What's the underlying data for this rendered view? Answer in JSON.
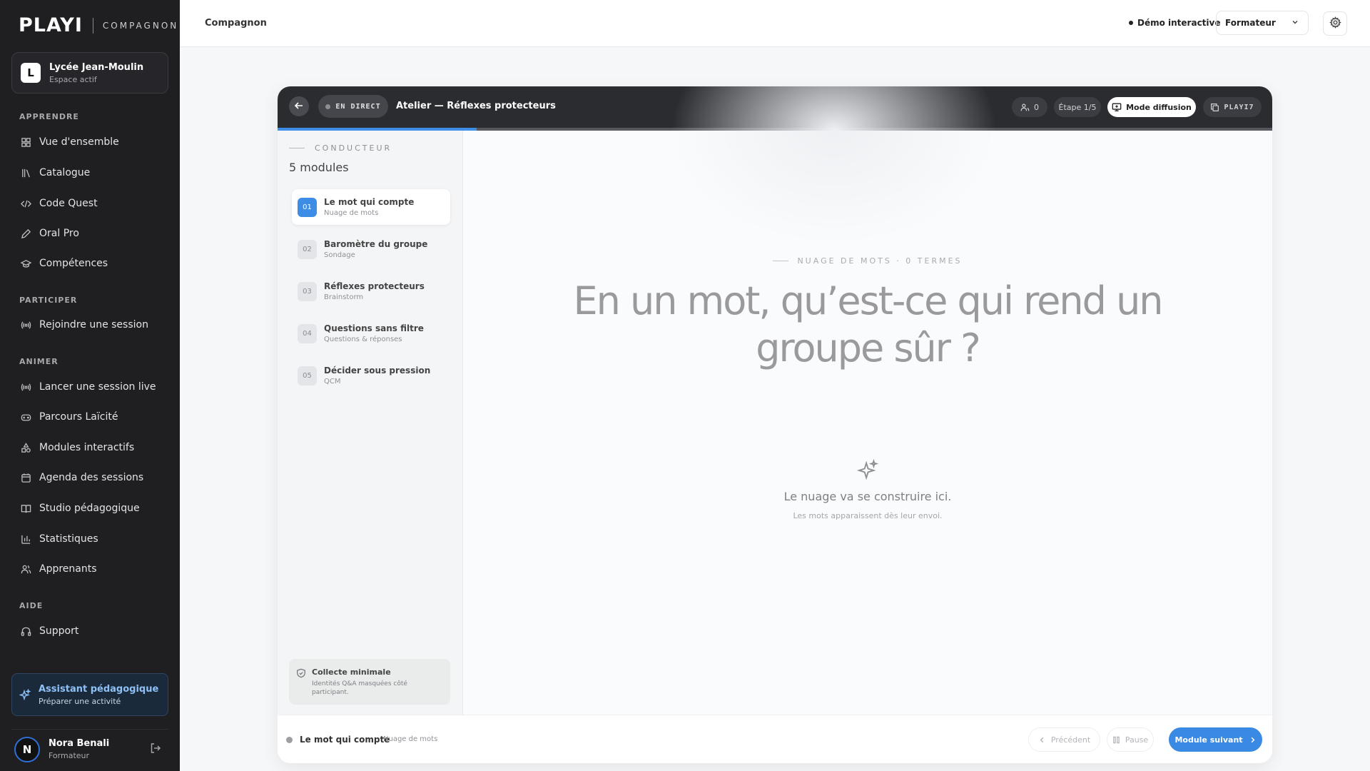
{
  "brand": {
    "logo": "PLAYI",
    "sub": "COMPAGNON"
  },
  "workspace": {
    "initial": "L",
    "name": "Lycée Jean-Moulin",
    "status": "Espace actif"
  },
  "sidebar": {
    "sections": [
      {
        "label": "APPRENDRE",
        "items": [
          {
            "label": "Vue d'ensemble",
            "icon": "grid-icon"
          },
          {
            "label": "Catalogue",
            "icon": "library-icon"
          },
          {
            "label": "Code Quest",
            "icon": "code-icon"
          },
          {
            "label": "Oral Pro",
            "icon": "pen-icon"
          },
          {
            "label": "Compétences",
            "icon": "graduation-cap-icon"
          }
        ]
      },
      {
        "label": "PARTICIPER",
        "items": [
          {
            "label": "Rejoindre une session",
            "icon": "broadcast-icon"
          }
        ]
      },
      {
        "label": "ANIMER",
        "items": [
          {
            "label": "Lancer une session live",
            "icon": "broadcast-icon"
          },
          {
            "label": "Parcours Laïcité",
            "icon": "gamepad-icon"
          },
          {
            "label": "Modules interactifs",
            "icon": "shapes-icon"
          },
          {
            "label": "Agenda des sessions",
            "icon": "calendar-icon"
          },
          {
            "label": "Studio pédagogique",
            "icon": "book-icon"
          },
          {
            "label": "Statistiques",
            "icon": "bar-chart-icon"
          },
          {
            "label": "Apprenants",
            "icon": "users-icon"
          }
        ]
      },
      {
        "label": "AIDE",
        "items": [
          {
            "label": "Support",
            "icon": "headphones-icon"
          }
        ]
      }
    ],
    "assistant": {
      "title": "Assistant pédagogique",
      "subtitle": "Préparer une activité"
    },
    "user": {
      "initial": "N",
      "name": "Nora Benali",
      "role": "Formateur"
    }
  },
  "topbar": {
    "title": "Compagnon",
    "demo": "Démo interactive",
    "role_selected": "Formateur"
  },
  "session": {
    "live_label": "EN DIRECT",
    "title": "Atelier — Réflexes protecteurs",
    "participants": "0",
    "step": "Étape 1/5",
    "broadcast_label": "Mode diffusion",
    "code": "PLAYI7",
    "progress_fraction": 0.2
  },
  "modules": {
    "label": "CONDUCTEUR",
    "count": "5 modules",
    "items": [
      {
        "num": "01",
        "title": "Le mot qui compte",
        "type": "Nuage de mots",
        "active": true
      },
      {
        "num": "02",
        "title": "Baromètre du groupe",
        "type": "Sondage",
        "active": false
      },
      {
        "num": "03",
        "title": "Réflexes protecteurs",
        "type": "Brainstorm",
        "active": false
      },
      {
        "num": "04",
        "title": "Questions sans filtre",
        "type": "Questions & réponses",
        "active": false
      },
      {
        "num": "05",
        "title": "Décider sous pression",
        "type": "QCM",
        "active": false
      }
    ],
    "privacy": {
      "title": "Collecte minimale",
      "text": "Identités Q&A masquées côté participant."
    }
  },
  "stage": {
    "label": "NUAGE DE MOTS · 0 TERMES",
    "question": "En un mot, qu’est-ce qui rend un groupe sûr ?",
    "empty_title": "Le nuage va se construire ici.",
    "empty_sub": "Les mots apparaissent dès leur envoi."
  },
  "footer": {
    "title": "Le mot qui compte",
    "type": "Nuage de mots",
    "prev": "Précédent",
    "pause": "Pause",
    "next": "Module suivant"
  },
  "colors": {
    "accent": "#3a8ae4",
    "sidebar_bg": "#1f1f22",
    "header_bg": "#2b2c30"
  }
}
